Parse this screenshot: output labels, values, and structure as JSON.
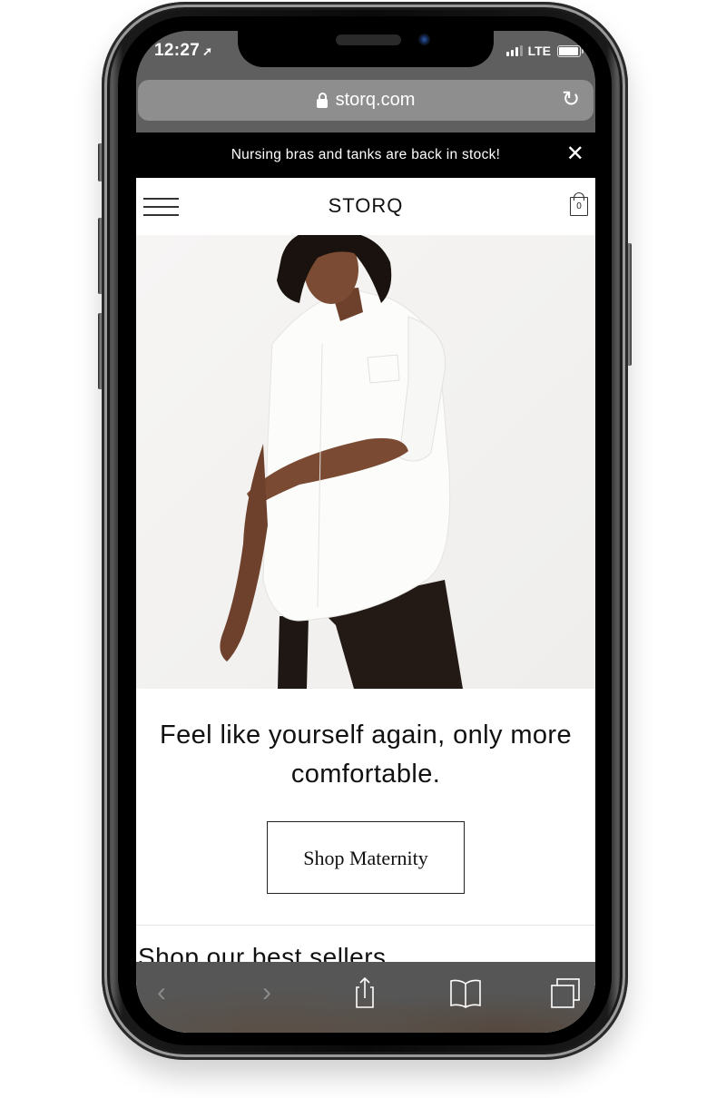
{
  "status_bar": {
    "time": "12:27",
    "location_icon": "location-arrow-icon",
    "network": "LTE",
    "signal_bars_active": 3,
    "signal_bars_total": 4,
    "battery_level": 0.95
  },
  "browser": {
    "url": "storq.com",
    "lock_icon": "lock-icon",
    "reload_icon": "reload-icon",
    "toolbar": [
      {
        "name": "back",
        "icon": "chevron-left-icon",
        "enabled": false
      },
      {
        "name": "forward",
        "icon": "chevron-right-icon",
        "enabled": false
      },
      {
        "name": "share",
        "icon": "share-icon",
        "enabled": true
      },
      {
        "name": "bookmarks",
        "icon": "book-icon",
        "enabled": true
      },
      {
        "name": "tabs",
        "icon": "tabs-icon",
        "enabled": true
      }
    ]
  },
  "promo_banner": {
    "text": "Nursing bras and tanks are back in stock!",
    "close_icon": "close-icon"
  },
  "header": {
    "menu_icon": "hamburger-menu-icon",
    "logo": "STORQ",
    "cart_count": "0",
    "cart_icon": "shopping-bag-icon"
  },
  "hero": {
    "image_alt": "Woman wearing white oversized button-up shirt and black leggings"
  },
  "main": {
    "headline": "Feel like yourself again, only more comfortable.",
    "cta_label": "Shop Maternity",
    "next_section_heading_partial": "Shop our best sellers"
  },
  "colors": {
    "promo_bg": "#000000",
    "page_bg": "#ffffff",
    "browser_chrome": "#5f5f5f",
    "url_bar": "#8e8e8e",
    "text": "#111111"
  }
}
